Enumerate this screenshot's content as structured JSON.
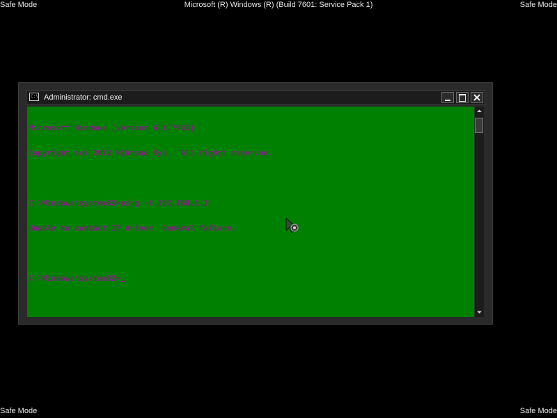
{
  "screen": {
    "background": "#000000",
    "safe_mode_label_top_left": "Safe Mode",
    "safe_mode_label_top_right": "Safe Mode",
    "safe_mode_label_bottom_left": "Safe Mode",
    "safe_mode_label_bottom_right": "Safe Mode",
    "build_info": "Microsoft (R) Windows (R) (Build 7601: Service Pack 1)"
  },
  "window": {
    "title": "Administrator: cmd.exe",
    "icon": "cmd-console-icon",
    "icon_text": "C:\\",
    "buttons": {
      "minimize": "minimize-icon",
      "maximize": "maximize-icon",
      "close": "close-icon"
    }
  },
  "console": {
    "background_color": "#008000",
    "text_color": "#7f1f7f",
    "lines": [
      "Microsoft Windows [Version 6.1.7601]",
      "Copyright (c) 2012 Nikhsad Sys.  All rights reserved.",
      "",
      "C:\\Windows\\system32>ping -t 192.168.1.1",
      "Unable to contact IP driver. General failure.",
      "",
      "C:\\Windows\\system32>"
    ]
  },
  "scrollbar": {
    "up_arrow": "chevron-up-icon",
    "down_arrow": "chevron-down-icon"
  },
  "mouse": {
    "icon": "mouse-pointer-icon"
  }
}
